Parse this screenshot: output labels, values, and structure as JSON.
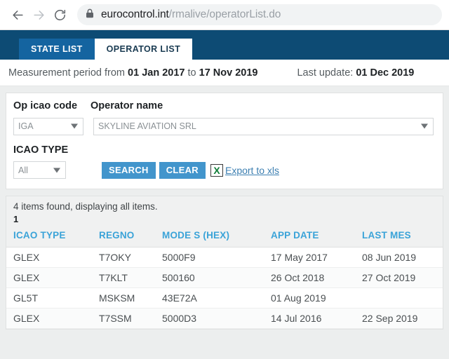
{
  "browser": {
    "back_icon": "arrow-left-icon",
    "forward_icon": "arrow-right-icon",
    "reload_icon": "reload-icon",
    "lock_icon": "lock-icon",
    "url_host": "eurocontrol.int",
    "url_path": "/rmalive/operatorList.do"
  },
  "tabs": [
    {
      "label": "STATE LIST",
      "active": false
    },
    {
      "label": "OPERATOR LIST",
      "active": true
    }
  ],
  "period": {
    "prefix": "Measurement period from ",
    "from": "01 Jan 2017",
    "middle": " to ",
    "to": "17 Nov 2019",
    "update_prefix": "Last update: ",
    "update_date": "01 Dec 2019"
  },
  "search": {
    "op_icao_label": "Op icao code",
    "operator_name_label": "Operator name",
    "icao_type_label": "ICAO TYPE",
    "op_icao_value": "IGA",
    "operator_name_value": "SKYLINE AVIATION SRL",
    "icao_type_value": "All",
    "search_button": "SEARCH",
    "clear_button": "CLEAR",
    "export_link": "Export to xls",
    "export_icon": "excel-icon",
    "export_icon_glyph": "X"
  },
  "results": {
    "found_text": "4 items found, displaying all items.",
    "page_number": "1",
    "columns": [
      "ICAO TYPE",
      "REGNO",
      "MODE S (HEX)",
      "APP DATE",
      "LAST MES"
    ],
    "rows": [
      {
        "icao_type": "GLEX",
        "regno": "T7OKY",
        "mode_s": "5000F9",
        "app_date": "17 May 2017",
        "last_mes": "08 Jun 2019"
      },
      {
        "icao_type": "GLEX",
        "regno": "T7KLT",
        "mode_s": "500160",
        "app_date": "26 Oct 2018",
        "last_mes": "27 Oct 2019"
      },
      {
        "icao_type": "GL5T",
        "regno": "MSKSM",
        "mode_s": "43E72A",
        "app_date": "01 Aug 2019",
        "last_mes": ""
      },
      {
        "icao_type": "GLEX",
        "regno": "T7SSM",
        "mode_s": "5000D3",
        "app_date": "14 Jul 2016",
        "last_mes": "22 Sep 2019"
      }
    ]
  },
  "colors": {
    "tabbar_bg": "#0d4b74",
    "tab_inactive_bg": "#1464a0",
    "button_blue": "#4295cc",
    "header_blue": "#3aa3d8",
    "link_blue": "#3c7fb1",
    "excel_green": "#0f7c37"
  }
}
